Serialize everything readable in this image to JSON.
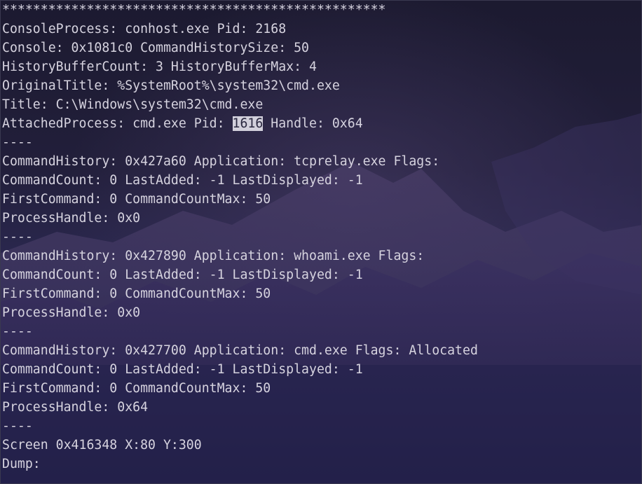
{
  "terminal": {
    "selection": {
      "line_index": 6,
      "text": "1616"
    },
    "lines": [
      "**************************************************",
      "ConsoleProcess: conhost.exe Pid: 2168",
      "Console: 0x1081c0 CommandHistorySize: 50",
      "HistoryBufferCount: 3 HistoryBufferMax: 4",
      "OriginalTitle: %SystemRoot%\\system32\\cmd.exe",
      "Title: C:\\Windows\\system32\\cmd.exe",
      "AttachedProcess: cmd.exe Pid: 1616 Handle: 0x64",
      "----",
      "CommandHistory: 0x427a60 Application: tcprelay.exe Flags:",
      "CommandCount: 0 LastAdded: -1 LastDisplayed: -1",
      "FirstCommand: 0 CommandCountMax: 50",
      "ProcessHandle: 0x0",
      "----",
      "CommandHistory: 0x427890 Application: whoami.exe Flags:",
      "CommandCount: 0 LastAdded: -1 LastDisplayed: -1",
      "FirstCommand: 0 CommandCountMax: 50",
      "ProcessHandle: 0x0",
      "----",
      "CommandHistory: 0x427700 Application: cmd.exe Flags: Allocated",
      "CommandCount: 0 LastAdded: -1 LastDisplayed: -1",
      "FirstCommand: 0 CommandCountMax: 50",
      "ProcessHandle: 0x64",
      "----",
      "Screen 0x416348 X:80 Y:300",
      "Dump:"
    ]
  },
  "colors": {
    "text": "#d6d3df",
    "selection_bg": "#d2d0dc",
    "selection_fg": "#2a2840",
    "bg_top": "#1f1d36",
    "bg_bottom": "#24224a"
  }
}
